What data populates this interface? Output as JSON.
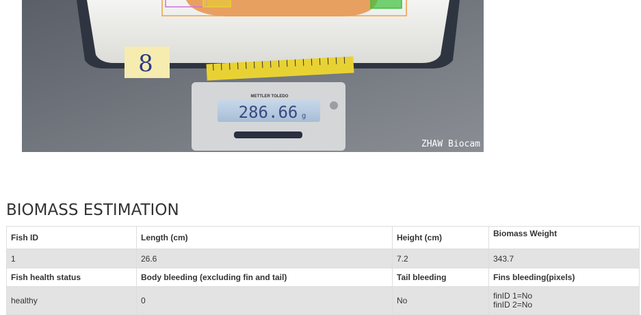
{
  "photo": {
    "tag_number": "8",
    "scale_brand": "METTLER TOLEDO",
    "scale_reading": "286.66",
    "scale_unit": "g",
    "watermark": "ZHAW Biocam"
  },
  "section": {
    "title": "BIOMASS ESTIMATION"
  },
  "table": {
    "headers1": [
      "Fish ID",
      "Length (cm)",
      "Height (cm)",
      "Biomass Weight"
    ],
    "values1": [
      "1",
      "26.6",
      "7.2",
      "343.7"
    ],
    "headers2": [
      "Fish health status",
      "Body bleeding (excluding fin and tail)",
      "Tail bleeding",
      "Fins bleeding(pixels)"
    ],
    "values2": [
      "healthy",
      "0",
      "No"
    ],
    "fins": [
      "finID 1=No",
      "finID 2=No"
    ]
  }
}
